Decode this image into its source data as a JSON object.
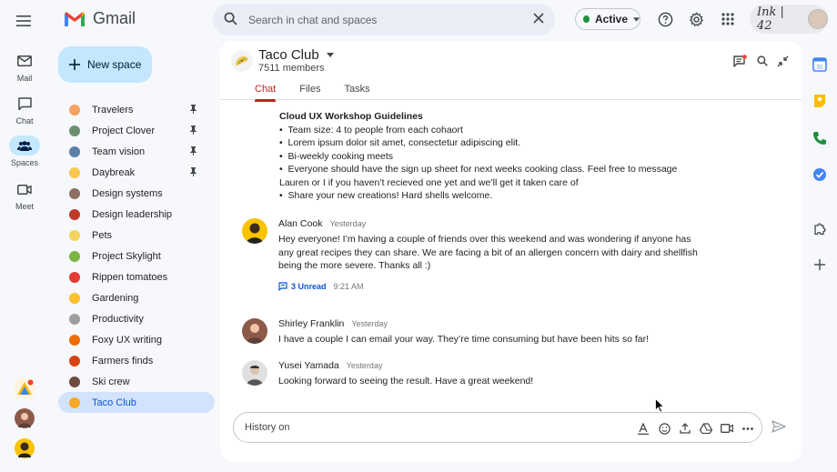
{
  "app": {
    "name": "Gmail"
  },
  "search": {
    "placeholder": "Search in chat and spaces"
  },
  "status": {
    "label": "Active",
    "color": "#1e8e3e"
  },
  "account": {
    "brand": "Ink | 42"
  },
  "rail": {
    "items": [
      {
        "label": "Mail",
        "icon": "mail-icon"
      },
      {
        "label": "Chat",
        "icon": "chat-icon"
      },
      {
        "label": "Spaces",
        "icon": "spaces-icon",
        "active": true
      },
      {
        "label": "Meet",
        "icon": "meet-icon"
      }
    ]
  },
  "new_space": {
    "label": "New space"
  },
  "spaces": [
    {
      "name": "Travelers",
      "pinned": true,
      "color": "#f4a261"
    },
    {
      "name": "Project Clover",
      "pinned": true,
      "color": "#6b8f71"
    },
    {
      "name": "Team vision",
      "pinned": true,
      "color": "#5b7fa6"
    },
    {
      "name": "Daybreak",
      "pinned": true,
      "color": "#f9c74f"
    },
    {
      "name": "Design systems",
      "pinned": false,
      "color": "#8d6e63"
    },
    {
      "name": "Design leadership",
      "pinned": false,
      "color": "#c0392b"
    },
    {
      "name": "Pets",
      "pinned": false,
      "color": "#f4d35e"
    },
    {
      "name": "Project Skylight",
      "pinned": false,
      "color": "#7cb342"
    },
    {
      "name": "Rippen tomatoes",
      "pinned": false,
      "color": "#e53935"
    },
    {
      "name": "Gardening",
      "pinned": false,
      "color": "#fbc02d"
    },
    {
      "name": "Productivity",
      "pinned": false,
      "color": "#9e9e9e"
    },
    {
      "name": "Foxy UX writing",
      "pinned": false,
      "color": "#ef6c00"
    },
    {
      "name": "Farmers finds",
      "pinned": false,
      "color": "#d84315"
    },
    {
      "name": "Ski crew",
      "pinned": false,
      "color": "#6d4c41"
    },
    {
      "name": "Taco Club",
      "pinned": false,
      "color": "#f9a825",
      "active": true
    }
  ],
  "room": {
    "title": "Taco Club",
    "members": "7511 members",
    "tabs": [
      "Chat",
      "Files",
      "Tasks"
    ]
  },
  "guidelines": {
    "title": "Cloud UX Workshop Guidelines",
    "items": [
      "Team size: 4 to people from each cohaort",
      "Lorem ipsum dolor sit amet, consectetur adipiscing elit.",
      "Bi-weekly cooking meets",
      "Everyone should have the sign up sheet for next weeks cooking class. Feel free to message Lauren or I if you haven’t recieved one yet and we’ll get it taken care of",
      "Share your new creations! Hard shells welcome."
    ]
  },
  "messages": [
    {
      "author": "Alan Cook",
      "time": "Yesterday",
      "text": "Hey everyone! I’m having a couple of friends over this weekend and was wondering if anyone has any great recipes they can share. We are facing a bit of an allergen concern with dairy and shellfish being the more severe. Thanks all :)",
      "thread": {
        "unread": "3 Unread",
        "time": "9:21 AM"
      }
    },
    {
      "author": "Shirley Franklin",
      "time": "Yesterday",
      "text": "I have a couple I can email your way. They’re time consuming but have been hits so far!"
    },
    {
      "author": "Yusei Yamada",
      "time": "Yesterday",
      "text": "Looking forward to seeing the result. Have a great weekend!"
    }
  ],
  "composer": {
    "placeholder": "History on"
  }
}
